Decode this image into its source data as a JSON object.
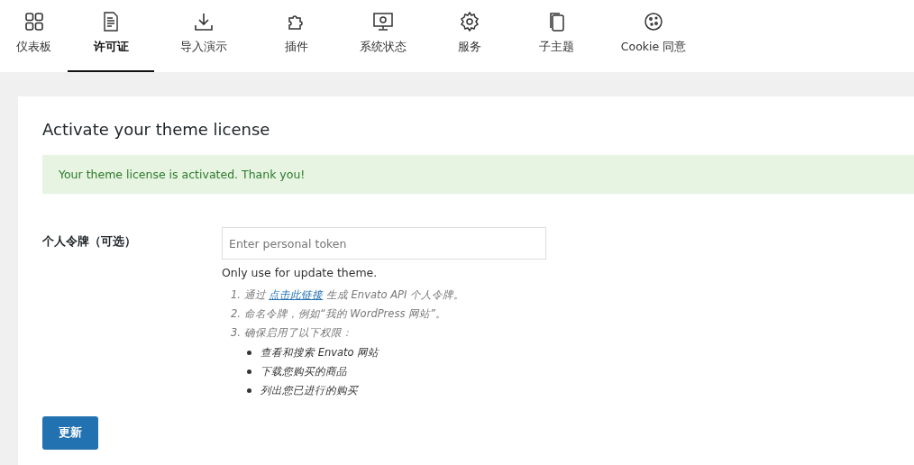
{
  "tabs": [
    {
      "label": "仪表板",
      "selected": false
    },
    {
      "label": "许可证",
      "selected": true
    },
    {
      "label": "导入演示",
      "selected": false
    },
    {
      "label": "插件",
      "selected": false
    },
    {
      "label": "系统状态",
      "selected": false
    },
    {
      "label": "服务",
      "selected": false
    },
    {
      "label": "子主题",
      "selected": false
    },
    {
      "label": "Cookie 同意",
      "selected": false
    }
  ],
  "card": {
    "title": "Activate your theme license",
    "notice": "Your theme license is activated. Thank you!",
    "field": {
      "label": "个人令牌（可选）",
      "placeholder": "Enter personal token",
      "help": "Only use for update theme."
    },
    "steps": [
      {
        "before": "1. 通过 ",
        "link": "点击此链接",
        "after": " 生成 Envato API 个人令牌。"
      },
      {
        "before": "2. 命名令牌，例如“我的 WordPress 网站”。"
      },
      {
        "before": "3. 确保启用了以下权限："
      }
    ],
    "permissions": [
      "查看和搜索 Envato 网站",
      "下载您购买的商品",
      "列出您已进行的购买"
    ],
    "button": "更新"
  }
}
